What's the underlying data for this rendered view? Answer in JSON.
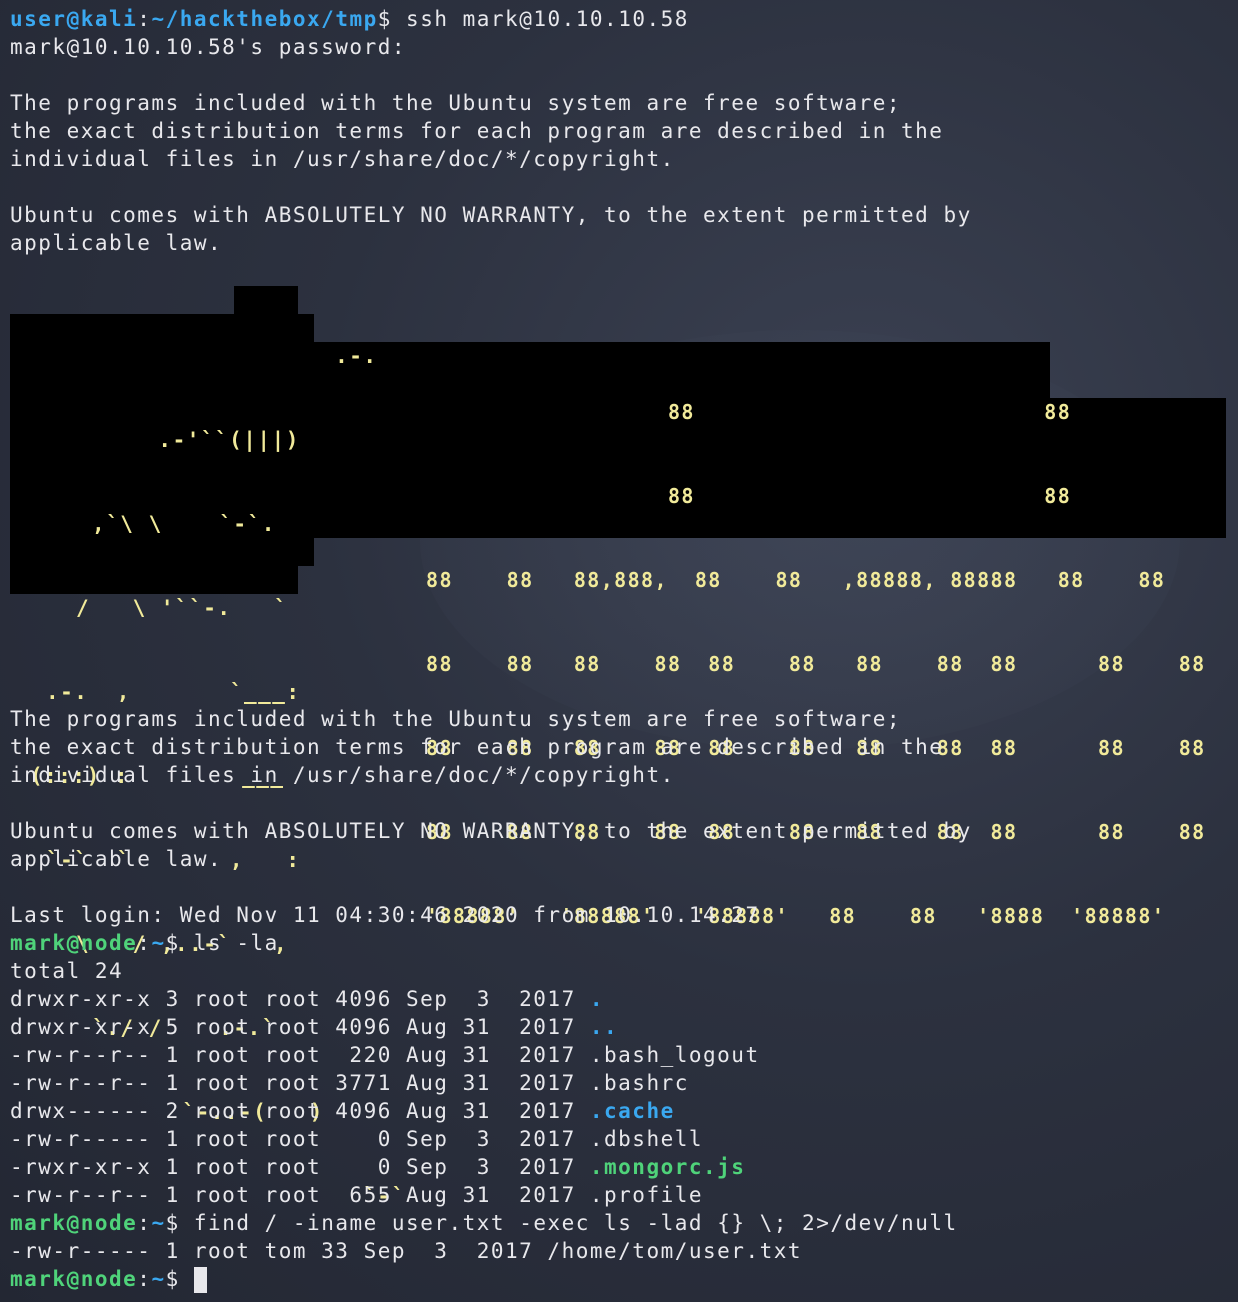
{
  "terminal": {
    "prompt1": {
      "user_host": "user@kali",
      "sep": ":",
      "path": "~/hackthebox/tmp",
      "sym": "$",
      "cmd": " ssh mark@10.10.10.58"
    },
    "password_prompt": "mark@10.10.10.58's password:",
    "motd1": [
      "The programs included with the Ubuntu system are free software;",
      "the exact distribution terms for each program are described in the",
      "individual files in /usr/share/doc/*/copyright."
    ],
    "warranty1": [
      "Ubuntu comes with ABSOLUTELY NO WARRANTY, to the extent permitted by",
      "applicable law."
    ],
    "ascii_logo": [
      "        .-.      ",
      "   .-'``(|||)    ",
      ",`\\ \\    `-`.    ",
      "/   \\ '``-.   `  ",
      ".-.  ,       `___:",
      "(:::) :        ___",
      "`-`  `       ,   :",
      "\\   / ,..-`   ,  ",
      "`./ /    .-.`    ",
      "   `-..-(   )    ",
      "         `-`     "
    ],
    "ascii_text": [
      "                  88                          88",
      "                  88                          88",
      "88    88   88,888,  88    88   ,88888, 88888   88    88",
      "88    88   88    88  88    88   88    88  88      88    88",
      "88    88   88    88  88    88   88    88  88      88    88",
      "88    88   88    88  88    88   88    88  88      88    88",
      "'88888'   '88888'   '88888'   88    88   '8888  '88888'"
    ],
    "motd2": [
      "The programs included with the Ubuntu system are free software;",
      "the exact distribution terms for each program are described in the",
      "individual files in /usr/share/doc/*/copyright."
    ],
    "warranty2": [
      "Ubuntu comes with ABSOLUTELY NO WARRANTY, to the extent permitted by",
      "applicable law."
    ],
    "last_login": "Last login: Wed Nov 11 04:30:46 2020 from 10.10.14.27",
    "prompt2": {
      "user_host": "mark@node",
      "sep": ":",
      "path": "~",
      "sym": "$",
      "cmd": " ls -la"
    },
    "total": "total 24",
    "ls_rows": [
      {
        "meta": "drwxr-xr-x 3 root root 4096 Sep  3  2017 ",
        "name": ".",
        "kind": "dir"
      },
      {
        "meta": "drwxr-xr-x 5 root root 4096 Aug 31  2017 ",
        "name": "..",
        "kind": "dir"
      },
      {
        "meta": "-rw-r--r-- 1 root root  220 Aug 31  2017 ",
        "name": ".bash_logout",
        "kind": "file"
      },
      {
        "meta": "-rw-r--r-- 1 root root 3771 Aug 31  2017 ",
        "name": ".bashrc",
        "kind": "file"
      },
      {
        "meta": "drwx------ 2 root root 4096 Aug 31  2017 ",
        "name": ".cache",
        "kind": "dir"
      },
      {
        "meta": "-rw-r----- 1 root root    0 Sep  3  2017 ",
        "name": ".dbshell",
        "kind": "file"
      },
      {
        "meta": "-rwxr-xr-x 1 root root    0 Sep  3  2017 ",
        "name": ".mongorc.js",
        "kind": "exec"
      },
      {
        "meta": "-rw-r--r-- 1 root root  655 Aug 31  2017 ",
        "name": ".profile",
        "kind": "file"
      }
    ],
    "prompt3": {
      "user_host": "mark@node",
      "sep": ":",
      "path": "~",
      "sym": "$",
      "cmd": " find / -iname user.txt -exec ls -lad {} \\; 2>/dev/null"
    },
    "find_result": "-rw-r----- 1 root tom 33 Sep  3  2017 /home/tom/user.txt",
    "prompt4": {
      "user_host": "mark@node",
      "sep": ":",
      "path": "~",
      "sym": "$ "
    }
  }
}
